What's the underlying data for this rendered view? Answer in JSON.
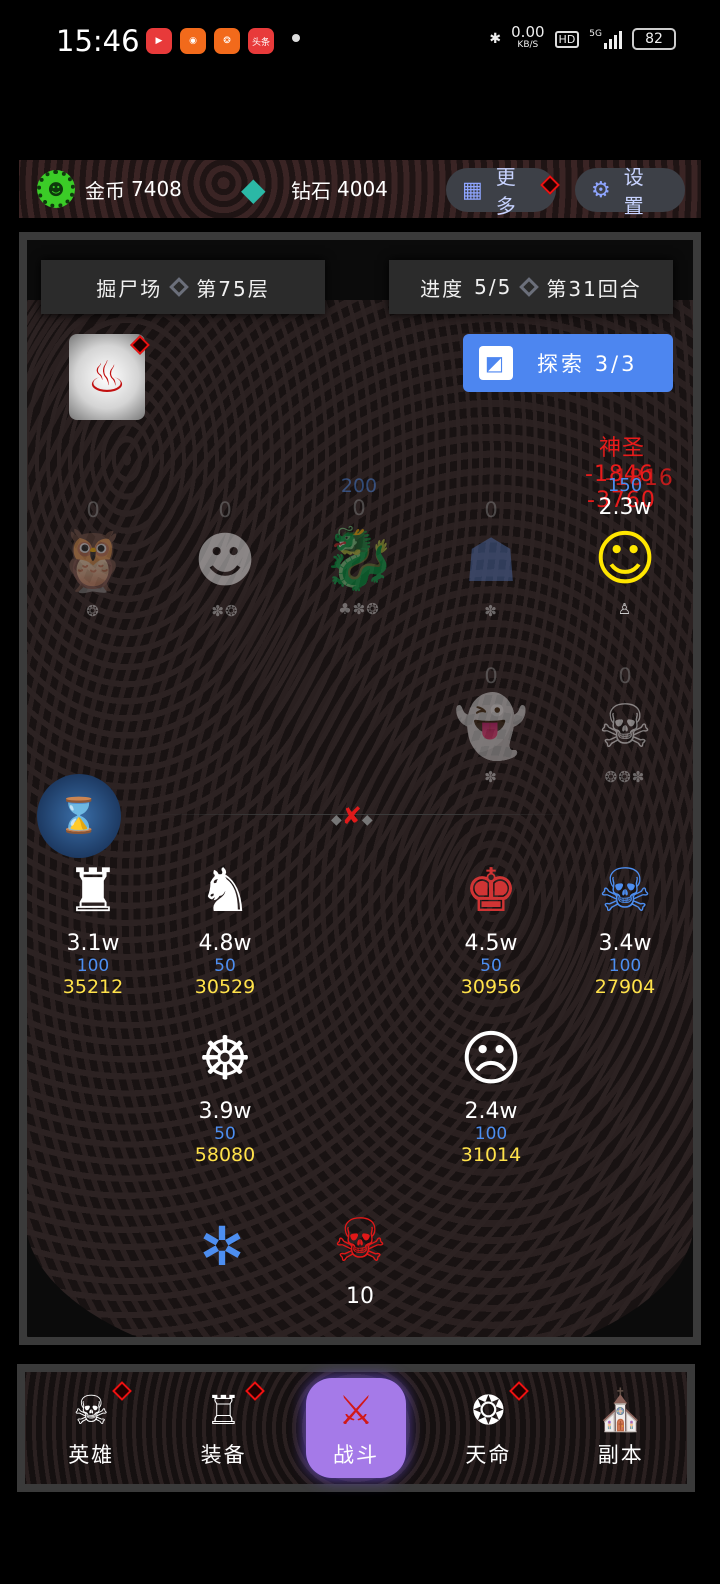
{
  "status_bar": {
    "time": "15:46",
    "apps": [
      "▶",
      "◉",
      "❂",
      "头条"
    ],
    "speed_value": "0.00",
    "speed_unit": "KB/S",
    "hd": "HD",
    "network": "5G",
    "battery": "82"
  },
  "currency": {
    "gold_label": "金币",
    "gold_value": "7408",
    "diamond_label": "钻石",
    "diamond_value": "4004",
    "more_label": "更多",
    "settings_label": "设置"
  },
  "stage": {
    "location": "掘尸场",
    "floor": "第75层",
    "progress_label": "进度",
    "progress": "5/5",
    "round": "第31回合"
  },
  "explore": {
    "label": "探索",
    "count": "3/3"
  },
  "damage_popups": [
    "神圣",
    "-1846",
    "-1816",
    "-3760"
  ],
  "enemies_row1": [
    {
      "name": "owl-monster",
      "glyph": "🦉",
      "value": "0",
      "status": "❂",
      "dim": true
    },
    {
      "name": "mummy",
      "glyph": "☻",
      "value": "0",
      "status": "✽❂",
      "dim": true
    },
    {
      "name": "red-dragon",
      "glyph": "🐉",
      "value": "0",
      "mana": "200",
      "status": "♣✽❂",
      "dim": true
    },
    {
      "name": "blue-idol",
      "glyph": "☗",
      "value": "0",
      "status": "✽",
      "dim": true
    },
    {
      "name": "yellow-mage",
      "glyph": "☺",
      "value": "2.3w",
      "mana": "150",
      "status": "♙",
      "dim": false
    }
  ],
  "enemies_row2": [
    {
      "name": "blue-ghost",
      "glyph": "👻",
      "value": "0",
      "status": "✽",
      "dim": true
    },
    {
      "name": "sugar-skull",
      "glyph": "☠",
      "value": "0",
      "status": "❂❂✽",
      "dim": true
    }
  ],
  "heroes_row1": [
    {
      "name": "viking-helm",
      "glyph": "♜",
      "hp": "3.1w",
      "mp": "100",
      "atk": "35212"
    },
    {
      "name": "knight-sword",
      "glyph": "♞",
      "hp": "4.8w",
      "mp": "50",
      "atk": "30529"
    },
    {
      "name": "red-brute",
      "glyph": "♚",
      "hp": "4.5w",
      "mp": "50",
      "atk": "30956"
    },
    {
      "name": "pirate-captain",
      "glyph": "☠",
      "hp": "3.4w",
      "mp": "100",
      "atk": "27904"
    }
  ],
  "heroes_row2": [
    {
      "name": "lion-dancer",
      "glyph": "☸",
      "hp": "3.9w",
      "mp": "50",
      "atk": "58080"
    },
    {
      "name": "cracked-mask",
      "glyph": "☹",
      "hp": "2.4w",
      "mp": "100",
      "atk": "31014"
    }
  ],
  "totem": {
    "value": "10"
  },
  "nav": [
    {
      "label": "英雄",
      "icon": "☠",
      "badge": true
    },
    {
      "label": "装备",
      "icon": "♖",
      "badge": true
    },
    {
      "label": "战斗",
      "icon": "⚔",
      "badge": false,
      "active": true
    },
    {
      "label": "天命",
      "icon": "❂",
      "badge": true
    },
    {
      "label": "副本",
      "icon": "⛪",
      "badge": false
    }
  ],
  "colors": {
    "gold_icon": "#3bcc27",
    "diamond_icon": "#2bb8a6",
    "explore_button": "#4d86f0",
    "mana": "#4d8ef0",
    "attack": "#ffe24a",
    "damage": "#e81b1b",
    "active_nav": "#a57ae8"
  }
}
